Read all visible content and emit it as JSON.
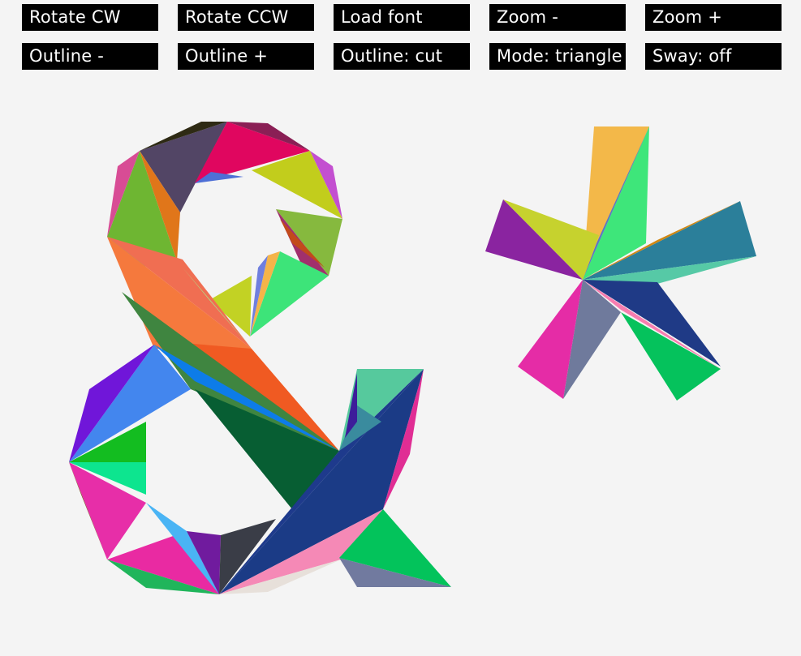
{
  "toolbar": {
    "rotate_cw": "Rotate CW",
    "rotate_ccw": "Rotate CCW",
    "load_font": "Load font",
    "zoom_out": "Zoom -",
    "zoom_in": "Zoom +",
    "outline_minus": "Outline -",
    "outline_plus": "Outline +",
    "outline_mode": "Outline: cut",
    "render_mode": "Mode: triangle",
    "sway": "Sway: off"
  },
  "canvas": {
    "glyphs": [
      "ampersand",
      "asterisk"
    ],
    "background_color": "#f4f4f4",
    "button_background": "#000000",
    "button_text_color": "#ffffff"
  }
}
